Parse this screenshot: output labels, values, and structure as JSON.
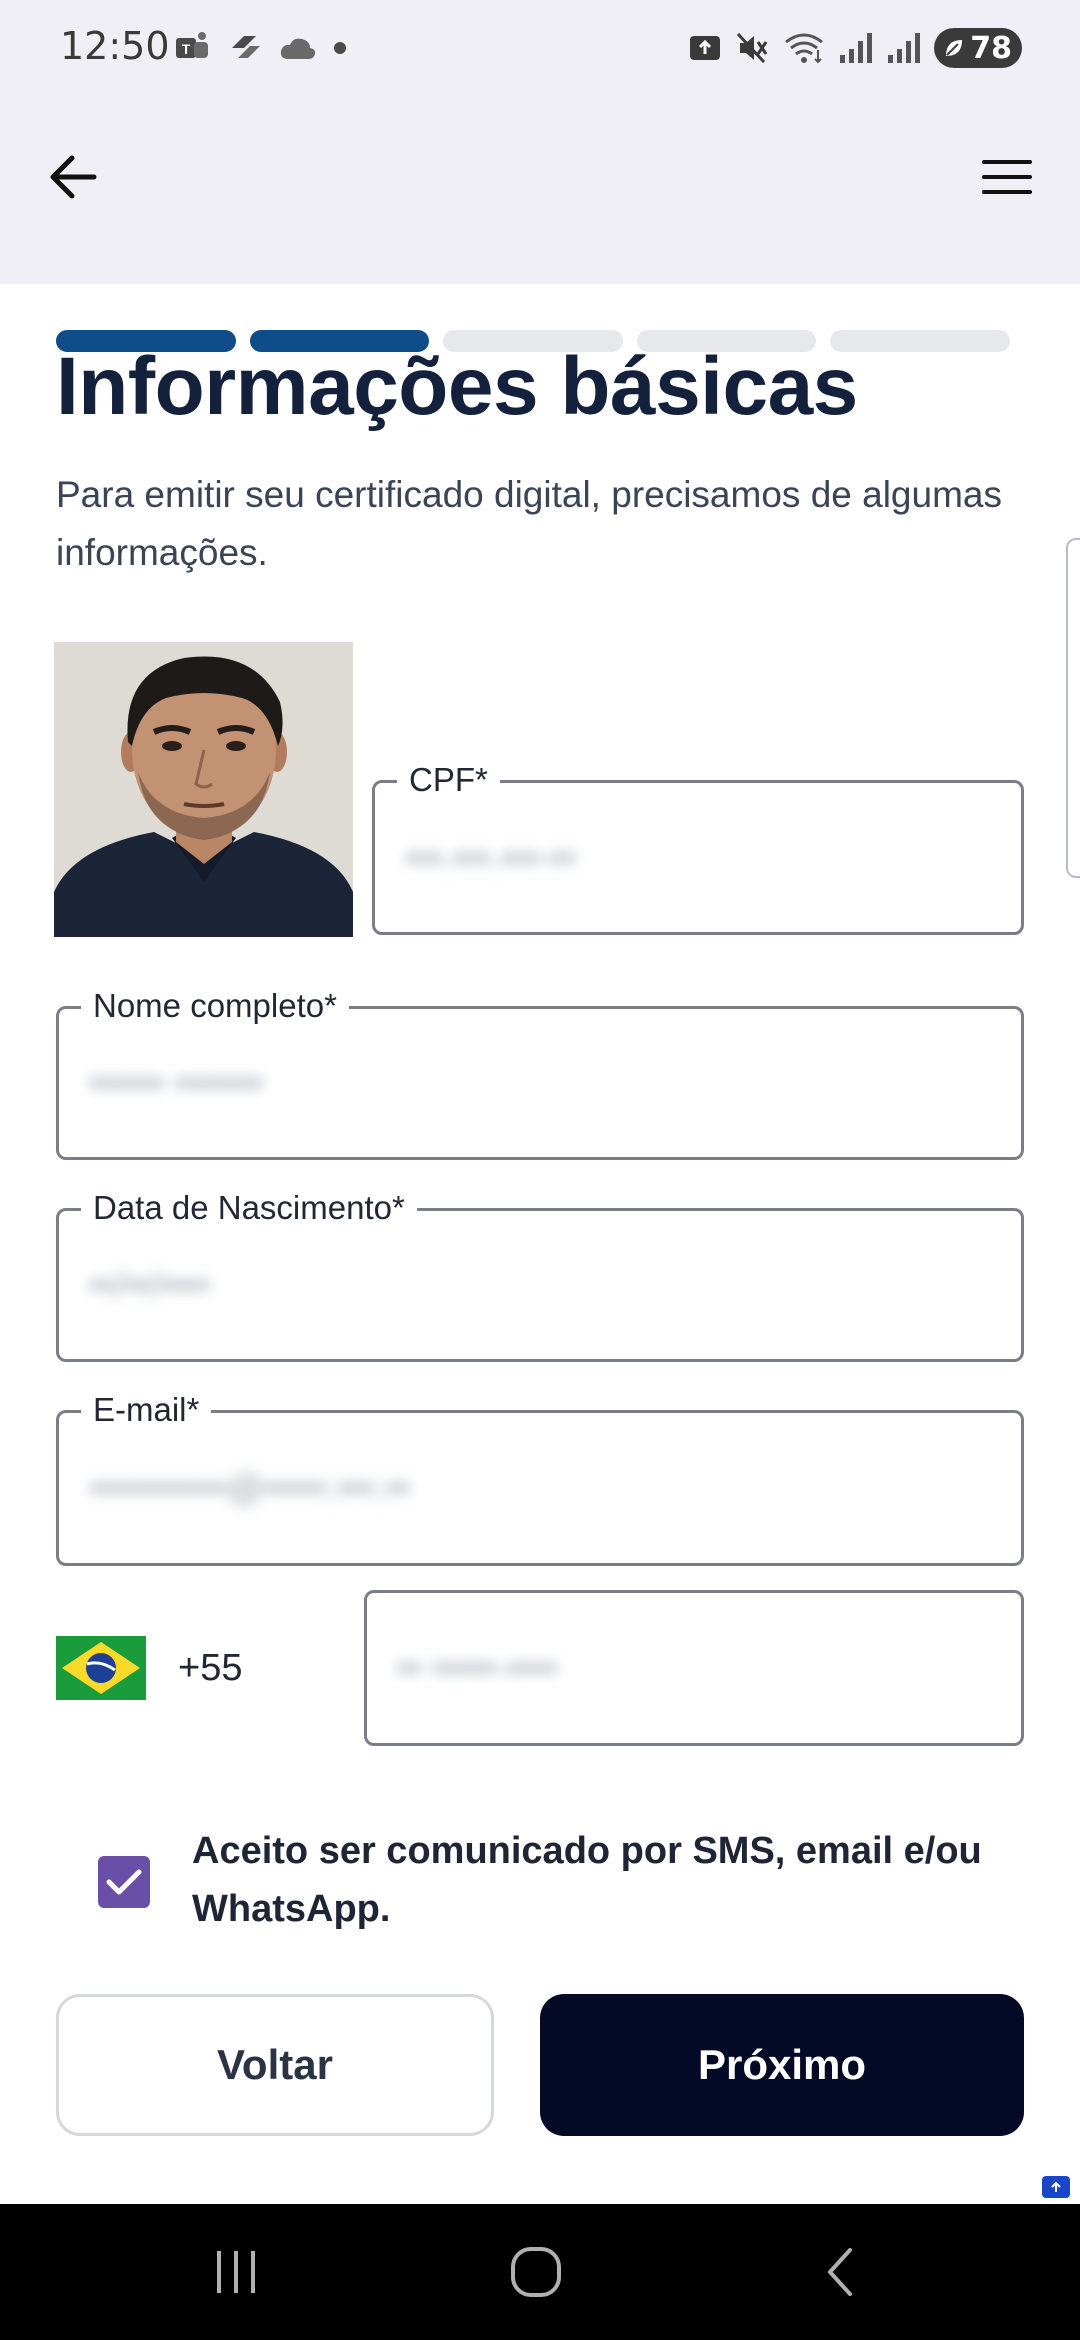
{
  "status_bar": {
    "time": "12:50",
    "battery": "78",
    "left_icons": [
      "teams-icon",
      "flow-icon",
      "cloud-icon",
      "dot-icon"
    ],
    "right_icons": [
      "upload-icon",
      "mute-icon",
      "wifi-icon",
      "signal-icon",
      "signal-icon"
    ]
  },
  "app_bar": {
    "back_icon": "arrow-left-icon",
    "menu_icon": "hamburger-menu-icon"
  },
  "progress": {
    "total_steps": 5,
    "completed_steps": 2
  },
  "page": {
    "title": "Informações básicas",
    "subtitle": "Para emitir seu certificado digital, precisamos de algumas informações."
  },
  "form": {
    "cpf": {
      "label": "CPF*",
      "value": "•••.•••.•••-••"
    },
    "nome": {
      "label": "Nome completo*",
      "value": "•••••• •••••••"
    },
    "nascimento": {
      "label": "Data de Nascimento*",
      "value": "••/••/••••"
    },
    "email": {
      "label": "E-mail*",
      "value": "•••••••••••@•••••.•••.••"
    },
    "phone": {
      "dial_code": "+55",
      "value": "•• •••••-••••"
    }
  },
  "consent": {
    "checked": true,
    "text": "Aceito ser comunicado por SMS, email e/ou WhatsApp."
  },
  "buttons": {
    "back": "Voltar",
    "next": "Próximo"
  },
  "colors": {
    "progress_done": "#0f4c8a",
    "primary_button": "#040a26",
    "checkbox": "#6a4fa8"
  }
}
